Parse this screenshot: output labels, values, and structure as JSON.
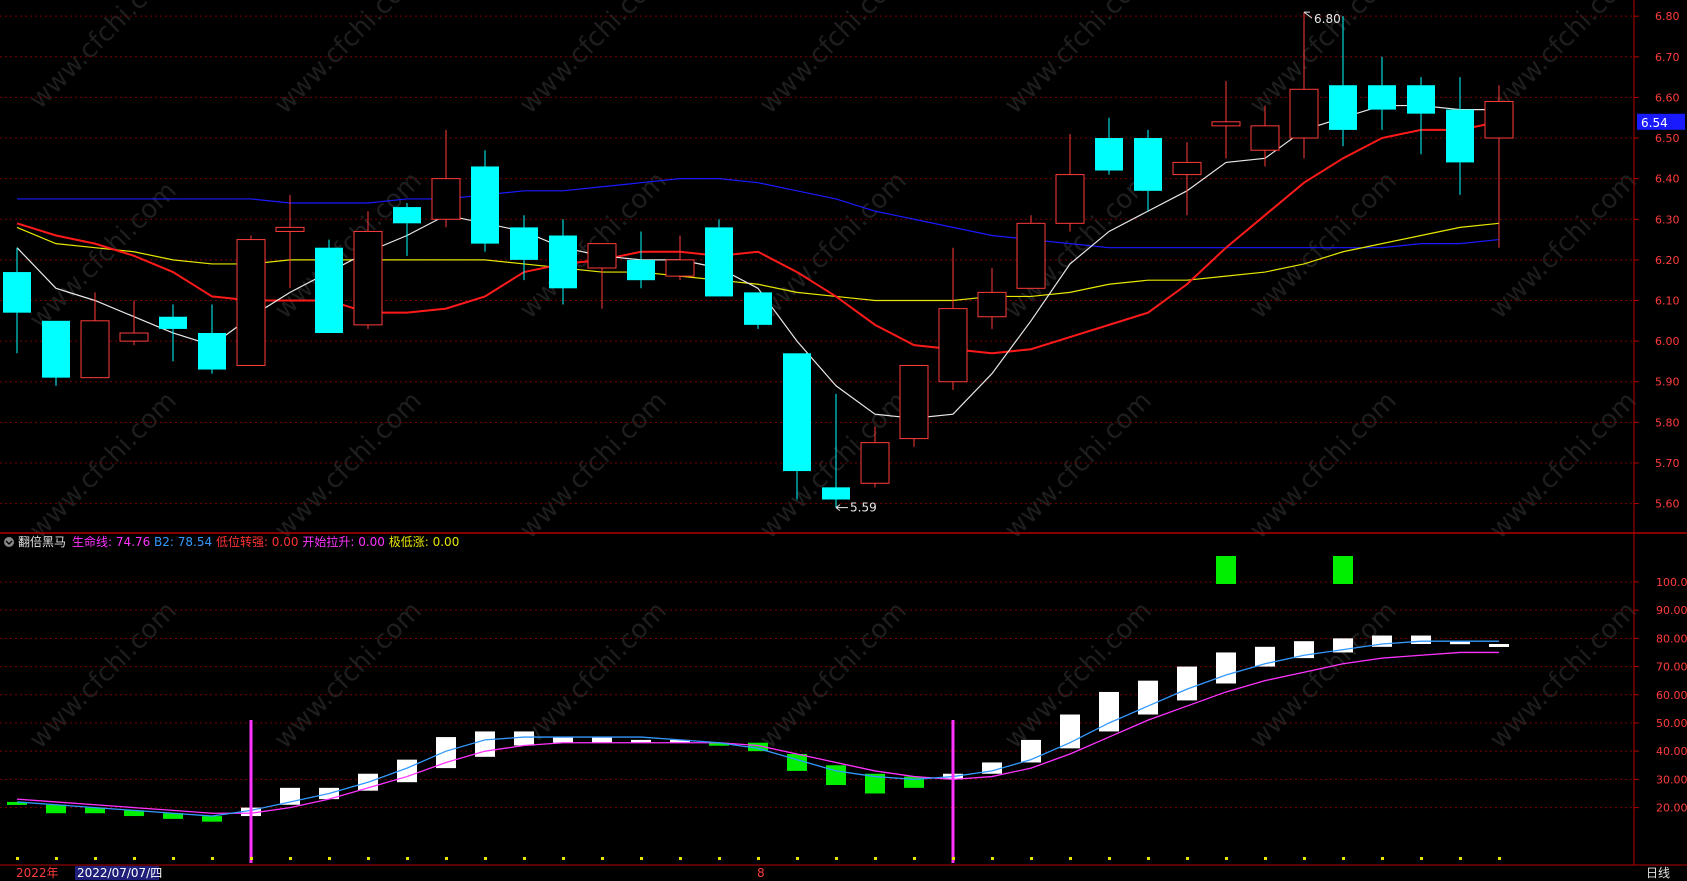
{
  "colors": {
    "up": "#ff3b3b",
    "down": "#00ffff",
    "border": "#b30000",
    "grid": "#7a0000",
    "axis_text": "#ff3c3c",
    "white_line": "#e8e8e8",
    "red_line": "#ff1a1a",
    "yellow_line": "#e6e600",
    "blue_line": "#1a1aff",
    "bar_white": "#ffffff",
    "bar_green": "#00ee00",
    "life_line": "#ff33ff",
    "b2_line": "#3399ff",
    "signal_magenta": "#ff33ff"
  },
  "price_panel": {
    "ylim": [
      5.53,
      6.83
    ],
    "y_ticks": [
      "6.80",
      "6.70",
      "6.60",
      "6.50",
      "6.40",
      "6.30",
      "6.20",
      "6.10",
      "6.00",
      "5.90",
      "5.80",
      "5.70",
      "5.60"
    ],
    "last_price_label": "6.54",
    "high_marker": "6.80",
    "low_marker": "5.59"
  },
  "indicator_panel": {
    "name": "翻倍黑马",
    "legend": [
      {
        "label": "生命线:",
        "value": "74.76",
        "color": "#ff33ff"
      },
      {
        "label": "B2:",
        "value": "78.54",
        "color": "#3399ff"
      },
      {
        "label": "低位转强:",
        "value": "0.00",
        "color": "#ff3333"
      },
      {
        "label": "开始拉升:",
        "value": "0.00",
        "color": "#ff33ff"
      },
      {
        "label": "极低涨:",
        "value": "0.00",
        "color": "#e6e600"
      }
    ],
    "ylim": [
      0,
      117
    ],
    "y_ticks": [
      "100.0",
      "90.00",
      "80.00",
      "70.00",
      "60.00",
      "50.00",
      "40.00",
      "30.00",
      "20.00"
    ]
  },
  "bottom_bar": {
    "year_label": "2022年",
    "date_label": "2022/07/07/四",
    "month_label": "8",
    "period_label": "日线"
  },
  "watermark": "www.cfchi.com",
  "chart_data": [
    {
      "type": "candlestick",
      "candles": [
        {
          "o": 6.17,
          "h": 6.23,
          "l": 5.97,
          "c": 6.07
        },
        {
          "o": 6.05,
          "h": 6.05,
          "l": 5.89,
          "c": 5.91
        },
        {
          "o": 5.91,
          "h": 6.12,
          "l": 5.91,
          "c": 6.05
        },
        {
          "o": 6.0,
          "h": 6.1,
          "l": 5.99,
          "c": 6.02
        },
        {
          "o": 6.06,
          "h": 6.09,
          "l": 5.95,
          "c": 6.03
        },
        {
          "o": 6.02,
          "h": 6.09,
          "l": 5.92,
          "c": 5.93
        },
        {
          "o": 5.94,
          "h": 6.26,
          "l": 5.94,
          "c": 6.25
        },
        {
          "o": 6.27,
          "h": 6.36,
          "l": 6.13,
          "c": 6.28
        },
        {
          "o": 6.23,
          "h": 6.25,
          "l": 6.02,
          "c": 6.02
        },
        {
          "o": 6.04,
          "h": 6.32,
          "l": 6.03,
          "c": 6.27
        },
        {
          "o": 6.33,
          "h": 6.34,
          "l": 6.21,
          "c": 6.29
        },
        {
          "o": 6.3,
          "h": 6.52,
          "l": 6.28,
          "c": 6.4
        },
        {
          "o": 6.43,
          "h": 6.47,
          "l": 6.22,
          "c": 6.24
        },
        {
          "o": 6.28,
          "h": 6.31,
          "l": 6.15,
          "c": 6.2
        },
        {
          "o": 6.26,
          "h": 6.3,
          "l": 6.09,
          "c": 6.13
        },
        {
          "o": 6.18,
          "h": 6.24,
          "l": 6.08,
          "c": 6.24
        },
        {
          "o": 6.2,
          "h": 6.27,
          "l": 6.13,
          "c": 6.15
        },
        {
          "o": 6.16,
          "h": 6.26,
          "l": 6.15,
          "c": 6.2
        },
        {
          "o": 6.28,
          "h": 6.3,
          "l": 6.11,
          "c": 6.11
        },
        {
          "o": 6.12,
          "h": 6.12,
          "l": 6.03,
          "c": 6.04
        },
        {
          "o": 5.97,
          "h": 5.97,
          "l": 5.61,
          "c": 5.68
        },
        {
          "o": 5.64,
          "h": 5.87,
          "l": 5.59,
          "c": 5.61
        },
        {
          "o": 5.65,
          "h": 5.79,
          "l": 5.64,
          "c": 5.75
        },
        {
          "o": 5.76,
          "h": 5.94,
          "l": 5.74,
          "c": 5.94
        },
        {
          "o": 5.9,
          "h": 6.23,
          "l": 5.88,
          "c": 6.08
        },
        {
          "o": 6.06,
          "h": 6.18,
          "l": 6.03,
          "c": 6.12
        },
        {
          "o": 6.13,
          "h": 6.31,
          "l": 6.13,
          "c": 6.29
        },
        {
          "o": 6.29,
          "h": 6.51,
          "l": 6.27,
          "c": 6.41
        },
        {
          "o": 6.5,
          "h": 6.55,
          "l": 6.41,
          "c": 6.42
        },
        {
          "o": 6.5,
          "h": 6.52,
          "l": 6.32,
          "c": 6.37
        },
        {
          "o": 6.41,
          "h": 6.49,
          "l": 6.31,
          "c": 6.44
        },
        {
          "o": 6.53,
          "h": 6.64,
          "l": 6.45,
          "c": 6.54
        },
        {
          "o": 6.47,
          "h": 6.58,
          "l": 6.43,
          "c": 6.53
        },
        {
          "o": 6.5,
          "h": 6.81,
          "l": 6.45,
          "c": 6.62
        },
        {
          "o": 6.63,
          "h": 6.8,
          "l": 6.48,
          "c": 6.52
        },
        {
          "o": 6.63,
          "h": 6.7,
          "l": 6.52,
          "c": 6.57
        },
        {
          "o": 6.63,
          "h": 6.65,
          "l": 6.46,
          "c": 6.56
        },
        {
          "o": 6.57,
          "h": 6.65,
          "l": 6.36,
          "c": 6.44
        },
        {
          "o": 6.5,
          "h": 6.63,
          "l": 6.23,
          "c": 6.59
        }
      ],
      "ma_white": [
        6.23,
        6.13,
        6.1,
        6.06,
        6.02,
        5.99,
        6.06,
        6.12,
        6.17,
        6.22,
        6.26,
        6.31,
        6.29,
        6.27,
        6.23,
        6.21,
        6.2,
        6.2,
        6.18,
        6.13,
        6.0,
        5.89,
        5.82,
        5.81,
        5.82,
        5.92,
        6.05,
        6.19,
        6.27,
        6.32,
        6.37,
        6.44,
        6.45,
        6.52,
        6.55,
        6.58,
        6.58,
        6.57,
        6.57
      ],
      "ma_red": [
        6.29,
        6.26,
        6.24,
        6.21,
        6.17,
        6.11,
        6.1,
        6.1,
        6.1,
        6.07,
        6.07,
        6.08,
        6.11,
        6.17,
        6.19,
        6.2,
        6.22,
        6.22,
        6.21,
        6.22,
        6.17,
        6.11,
        6.04,
        5.99,
        5.98,
        5.97,
        5.98,
        6.01,
        6.04,
        6.07,
        6.14,
        6.23,
        6.31,
        6.39,
        6.45,
        6.5,
        6.52,
        6.52,
        6.54
      ],
      "ma_yellow": [
        6.28,
        6.24,
        6.23,
        6.22,
        6.2,
        6.19,
        6.19,
        6.2,
        6.2,
        6.2,
        6.2,
        6.2,
        6.2,
        6.19,
        6.18,
        6.17,
        6.17,
        6.16,
        6.15,
        6.14,
        6.12,
        6.11,
        6.1,
        6.1,
        6.1,
        6.11,
        6.11,
        6.12,
        6.14,
        6.15,
        6.15,
        6.16,
        6.17,
        6.19,
        6.22,
        6.24,
        6.26,
        6.28,
        6.29
      ],
      "ma_blue": [
        6.35,
        6.35,
        6.35,
        6.35,
        6.35,
        6.35,
        6.35,
        6.34,
        6.34,
        6.34,
        6.35,
        6.35,
        6.36,
        6.37,
        6.37,
        6.38,
        6.39,
        6.4,
        6.4,
        6.39,
        6.37,
        6.35,
        6.32,
        6.3,
        6.28,
        6.26,
        6.25,
        6.24,
        6.23,
        6.23,
        6.23,
        6.23,
        6.23,
        6.23,
        6.23,
        6.23,
        6.24,
        6.24,
        6.25
      ]
    },
    {
      "type": "bar",
      "bars": [
        {
          "o": 21,
          "c": 22,
          "color": "green"
        },
        {
          "o": 21,
          "c": 18,
          "color": "green"
        },
        {
          "o": 20,
          "c": 18,
          "color": "green"
        },
        {
          "o": 19,
          "c": 17,
          "color": "green"
        },
        {
          "o": 18,
          "c": 16,
          "color": "green"
        },
        {
          "o": 17,
          "c": 15,
          "color": "green"
        },
        {
          "o": 17,
          "c": 20,
          "color": "white"
        },
        {
          "o": 21,
          "c": 27,
          "color": "white"
        },
        {
          "o": 23,
          "c": 27,
          "color": "white"
        },
        {
          "o": 26,
          "c": 32,
          "color": "white"
        },
        {
          "o": 29,
          "c": 37,
          "color": "white"
        },
        {
          "o": 34,
          "c": 45,
          "color": "white"
        },
        {
          "o": 38,
          "c": 47,
          "color": "white"
        },
        {
          "o": 42,
          "c": 47,
          "color": "white"
        },
        {
          "o": 43,
          "c": 45,
          "color": "white"
        },
        {
          "o": 43,
          "c": 45,
          "color": "white"
        },
        {
          "o": 43,
          "c": 44,
          "color": "white"
        },
        {
          "o": 43,
          "c": 44,
          "color": "white"
        },
        {
          "o": 43,
          "c": 42,
          "color": "green"
        },
        {
          "o": 43,
          "c": 40,
          "color": "green"
        },
        {
          "o": 39,
          "c": 33,
          "color": "green"
        },
        {
          "o": 35,
          "c": 28,
          "color": "green"
        },
        {
          "o": 32,
          "c": 25,
          "color": "green"
        },
        {
          "o": 31,
          "c": 27,
          "color": "green"
        },
        {
          "o": 30,
          "c": 32,
          "color": "white"
        },
        {
          "o": 32,
          "c": 36,
          "color": "white"
        },
        {
          "o": 36,
          "c": 44,
          "color": "white"
        },
        {
          "o": 41,
          "c": 53,
          "color": "white"
        },
        {
          "o": 47,
          "c": 61,
          "color": "white"
        },
        {
          "o": 53,
          "c": 65,
          "color": "white"
        },
        {
          "o": 58,
          "c": 70,
          "color": "white"
        },
        {
          "o": 64,
          "c": 75,
          "color": "white"
        },
        {
          "o": 70,
          "c": 77,
          "color": "white"
        },
        {
          "o": 73,
          "c": 79,
          "color": "white"
        },
        {
          "o": 75,
          "c": 80,
          "color": "white"
        },
        {
          "o": 77,
          "c": 81,
          "color": "white"
        },
        {
          "o": 78,
          "c": 81,
          "color": "white"
        },
        {
          "o": 78,
          "c": 79,
          "color": "white"
        },
        {
          "o": 78,
          "c": 78,
          "color": "white"
        }
      ],
      "b2_line": [
        22,
        21,
        20,
        19,
        18,
        17,
        19,
        22,
        25,
        29,
        34,
        40,
        44,
        45,
        45,
        45,
        45,
        44,
        43,
        41,
        37,
        33,
        31,
        30,
        31,
        33,
        37,
        43,
        50,
        56,
        62,
        67,
        71,
        74,
        76,
        78,
        79,
        79,
        79
      ],
      "life_line": [
        23,
        22,
        21,
        20,
        19,
        18,
        18,
        20,
        23,
        27,
        31,
        36,
        40,
        42,
        43,
        43,
        43,
        43,
        43,
        42,
        39,
        36,
        33,
        31,
        30,
        31,
        34,
        39,
        45,
        51,
        56,
        61,
        65,
        68,
        71,
        73,
        74,
        75,
        75
      ],
      "top_signals_at": [
        31,
        34
      ],
      "magenta_spikes_at": [
        6,
        24
      ]
    }
  ]
}
